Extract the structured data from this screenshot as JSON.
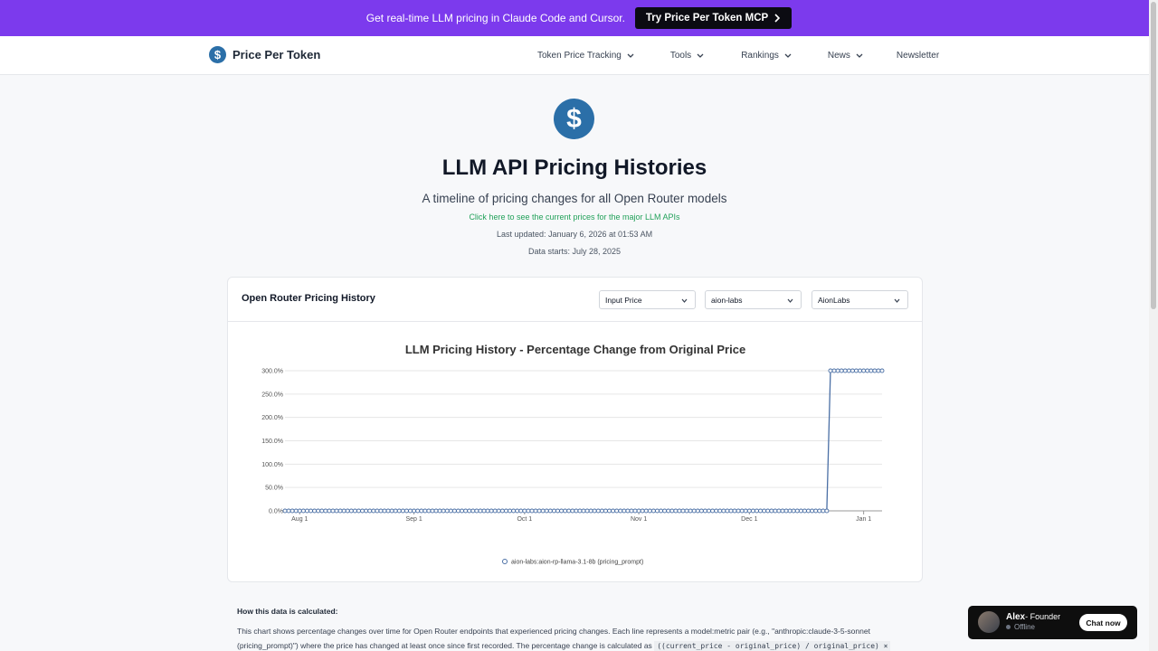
{
  "banner": {
    "text": "Get real-time LLM pricing in Claude Code and Cursor.",
    "button_label": "Try Price Per Token MCP"
  },
  "nav": {
    "brand": "Price Per Token",
    "brand_icon": "dollar-icon",
    "items": [
      {
        "label": "Token Price Tracking",
        "dropdown": true
      },
      {
        "label": "Tools",
        "dropdown": true
      },
      {
        "label": "Rankings",
        "dropdown": true
      },
      {
        "label": "News",
        "dropdown": true
      },
      {
        "label": "Newsletter",
        "dropdown": false
      }
    ]
  },
  "hero": {
    "title": "LLM API Pricing Histories",
    "subtitle": "A timeline of pricing changes for all Open Router models",
    "link": "Click here to see the current prices for the major LLM APIs",
    "last_updated": "Last updated: January 6, 2026 at 01:53 AM",
    "data_starts": "Data starts: July 28, 2025"
  },
  "card": {
    "title": "Open Router Pricing History",
    "selects": [
      {
        "value": "Input Price"
      },
      {
        "value": "aion-labs"
      },
      {
        "value": "AionLabs"
      }
    ]
  },
  "chart_data": {
    "type": "line",
    "title": "LLM Pricing History - Percentage Change from Original Price",
    "xlabel": "",
    "ylabel": "",
    "x_range": [
      "2025-07-28",
      "2026-01-06"
    ],
    "x_ticks": [
      "Aug 1",
      "Sep 1",
      "Oct 1",
      "Nov 1",
      "Dec 1",
      "Jan 1"
    ],
    "y_ticks": [
      "0.0%",
      "50.0%",
      "100.0%",
      "150.0%",
      "200.0%",
      "250.0%",
      "300.0%"
    ],
    "ylim": [
      0,
      300
    ],
    "grid": true,
    "legend": "bottom-center",
    "series": [
      {
        "name": "aion-labs:aion-rp-llama-3.1-8b (pricing_prompt)",
        "color": "#4a6fa5",
        "points": [
          {
            "x": "2025-07-28",
            "y": 0
          },
          {
            "x": "2025-12-22",
            "y": 0
          },
          {
            "x": "2025-12-23",
            "y": 300
          },
          {
            "x": "2026-01-06",
            "y": 300
          }
        ]
      }
    ]
  },
  "info": {
    "title": "How this data is calculated:",
    "text": "This chart shows percentage changes over time for Open Router endpoints that experienced pricing changes. Each line represents a model:metric pair (e.g., \"anthropic:claude-3-5-sonnet (pricing_prompt)\") where the price has changed at least once since first recorded. The percentage change is calculated as",
    "formula": "((current_price - original_price) / original_price) ×"
  },
  "chat": {
    "name": "Alex",
    "role": "- Founder",
    "status": "Offline",
    "button": "Chat now"
  }
}
